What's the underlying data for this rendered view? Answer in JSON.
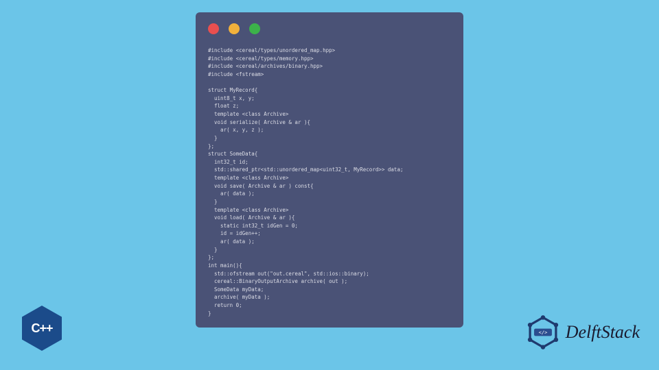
{
  "code": {
    "lines": [
      "#include <cereal/types/unordered_map.hpp>",
      "#include <cereal/types/memory.hpp>",
      "#include <cereal/archives/binary.hpp>",
      "#include <fstream>",
      "",
      "struct MyRecord{",
      "  uint8_t x, y;",
      "  float z;",
      "  template <class Archive>",
      "  void serialize( Archive & ar ){",
      "    ar( x, y, z );",
      "  }",
      "};",
      "struct SomeData{",
      "  int32_t id;",
      "  std::shared_ptr<std::unordered_map<uint32_t, MyRecord>> data;",
      "  template <class Archive>",
      "  void save( Archive & ar ) const{",
      "    ar( data );",
      "  }",
      "  template <class Archive>",
      "  void load( Archive & ar ){",
      "    static int32_t idGen = 0;",
      "    id = idGen++;",
      "    ar( data );",
      "  }",
      "};",
      "int main(){",
      "  std::ofstream out(\"out.cereal\", std::ios::binary);",
      "  cereal::BinaryOutputArchive archive( out );",
      "  SomeData myData;",
      "  archive( myData );",
      "  return 0;",
      "}"
    ]
  },
  "cpp_badge": {
    "label": "C++"
  },
  "brand": {
    "name": "DelftStack"
  }
}
